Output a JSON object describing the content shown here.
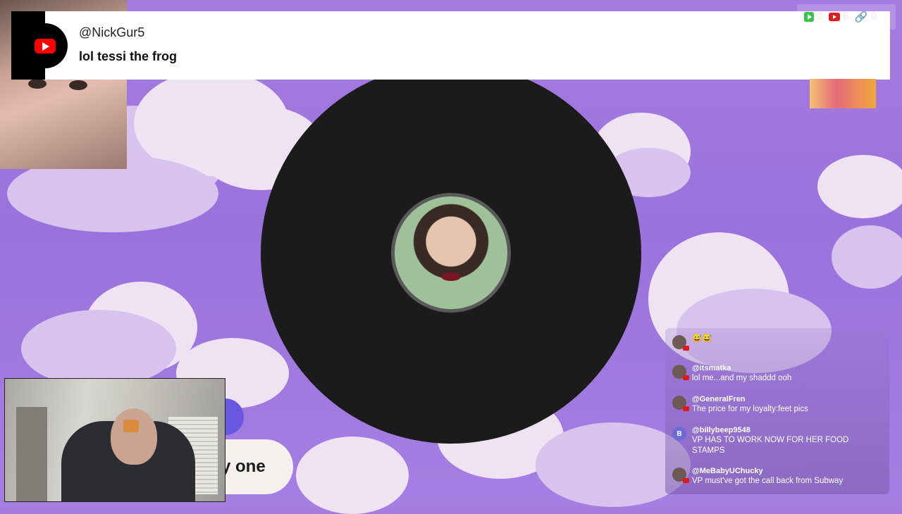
{
  "banner": {
    "username": "@NickGur5",
    "message": "lol tessi the frog",
    "platform_icon": "youtube-icon"
  },
  "stats": {
    "viewers_icon": "play-icon",
    "viewers": "3",
    "youtube_icon": "youtube-icon",
    "youtube": "6",
    "link_icon": "link-icon",
    "links": "0"
  },
  "caption": {
    "text": "y one"
  },
  "chat": {
    "messages": [
      {
        "user": "",
        "text": "😅😅",
        "avatar": "avatar"
      },
      {
        "user": "@itsmatka",
        "text": "lol me...and my shaddd ooh",
        "avatar": "avatar"
      },
      {
        "user": "@GeneralFren",
        "text": "The price for my loyalty:feet pics",
        "avatar": "avatar"
      },
      {
        "user": "@billybeep9548",
        "text": "VP HAS TO WORK NOW FOR HER FOOD STAMPS",
        "avatar": "B"
      },
      {
        "user": "@MeBabyUChucky",
        "text": "VP must've got the call back from Subway",
        "avatar": "avatar"
      }
    ]
  },
  "colors": {
    "background": "#a47ce0",
    "vinyl": "#1b1b1b",
    "youtube_red": "#ff0000"
  }
}
